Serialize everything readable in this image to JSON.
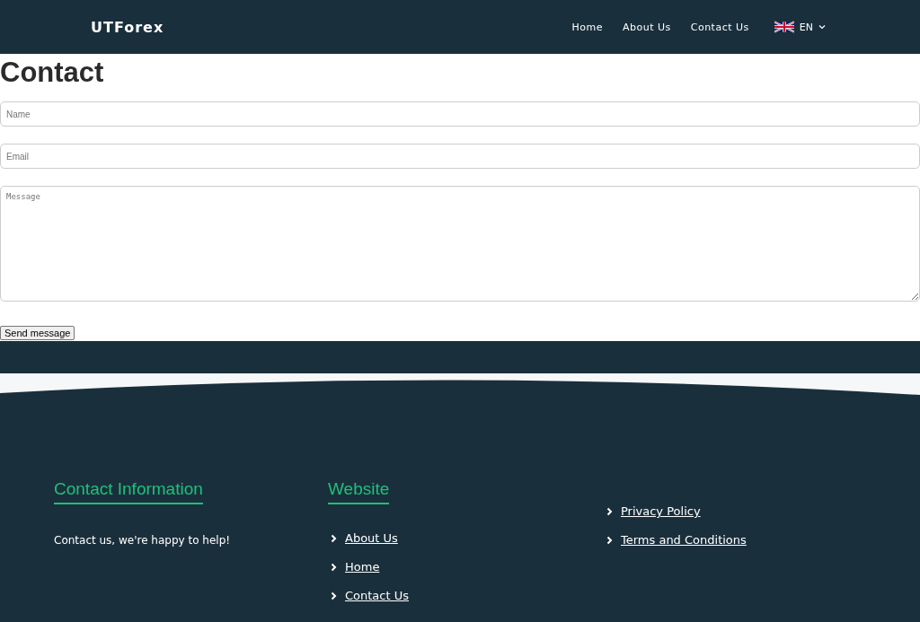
{
  "header": {
    "logo": "UTForex",
    "nav": [
      "Home",
      "About Us",
      "Contact Us"
    ],
    "language": "EN"
  },
  "page": {
    "title": "Contact",
    "form": {
      "fields": [
        {
          "kind": "input",
          "placeholder": "Name"
        },
        {
          "kind": "input",
          "placeholder": "Email"
        },
        {
          "kind": "textarea",
          "placeholder": "Message"
        }
      ],
      "submit": "Send message"
    }
  },
  "footer": {
    "columns": [
      {
        "heading": "Contact Information",
        "text": "Contact us, we're happy to help!"
      },
      {
        "heading": "Website",
        "links": [
          "About Us",
          "Home",
          "Contact Us"
        ]
      },
      {
        "links": [
          "Privacy Policy",
          "Terms and Conditions"
        ]
      }
    ]
  }
}
